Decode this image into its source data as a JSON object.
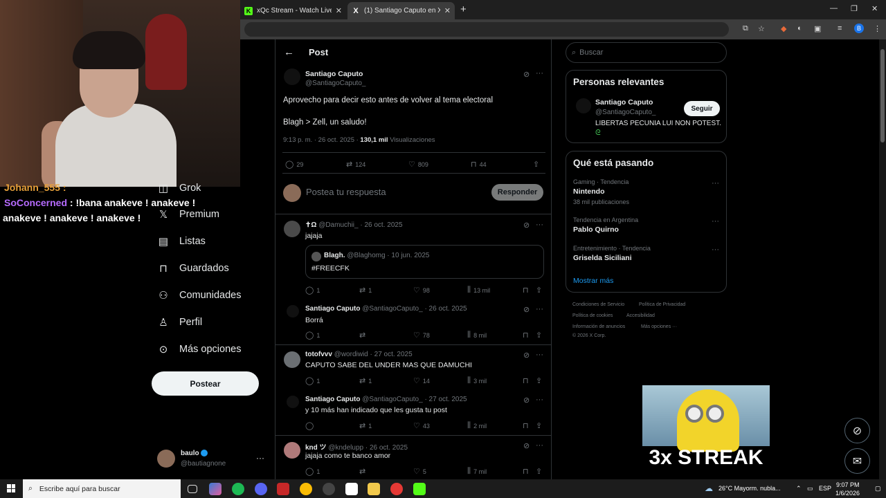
{
  "browser": {
    "tabs": [
      {
        "label": "xQc Stream - Watch Live on Kick",
        "favicon": "K"
      },
      {
        "label": "(1) Santiago Caputo en X: \"Aprovecho",
        "favicon": "X"
      }
    ],
    "new_tab": "+",
    "window_controls": [
      "—",
      "❐",
      "✕"
    ],
    "toolbar_profile": "B"
  },
  "stream": {
    "chat": [
      {
        "user": "Johann_555",
        "sep": " : ",
        "text": ""
      },
      {
        "user": "SoConcerned",
        "sep": " : ",
        "text": "!bana anakeve ! anakeve !"
      },
      {
        "user": "",
        "sep": "",
        "text": "anakeve ! anakeve ! anakeve !"
      }
    ],
    "streak_text": "3x STREAK"
  },
  "nav": {
    "items": [
      {
        "label": "Grok",
        "icon": "grok-icon"
      },
      {
        "label": "Premium",
        "icon": "x-logo-icon"
      },
      {
        "label": "Listas",
        "icon": "list-icon"
      },
      {
        "label": "Guardados",
        "icon": "bookmark-icon"
      },
      {
        "label": "Comunidades",
        "icon": "communities-icon"
      },
      {
        "label": "Perfil",
        "icon": "profile-icon"
      },
      {
        "label": "Más opciones",
        "icon": "more-circle-icon"
      }
    ],
    "post_button": "Postear",
    "account": {
      "name": "baulo",
      "handle": "@bautiagnone"
    }
  },
  "main": {
    "header": "Post",
    "tweet": {
      "name": "Santiago Caputo",
      "handle": "@SantiagoCaputo_",
      "text1": "Aprovecho para decir esto antes de volver al tema electoral",
      "text2": "Blagh > Zell, un saludo!",
      "meta": "9:13 p. m. · 26 oct. 2025 · ",
      "views": "130,1 mil",
      "views_label": " Visualizaciones",
      "replies": "29",
      "retweets": "124",
      "likes": "809",
      "bookmarks": "44"
    },
    "reply_placeholder": "Postea tu respuesta",
    "reply_button": "Responder",
    "replies": [
      {
        "name": "✝Ω",
        "handle": "@Damuchii_ · 26 oct. 2025",
        "text": "jajaja",
        "quote": {
          "name": "Blagh.",
          "handle": "@Blaghomg · 10 jun. 2025",
          "text": "#FREECFK"
        },
        "stats": {
          "replies": "1",
          "retweets": "1",
          "likes": "98",
          "views": "13 mil"
        }
      },
      {
        "name": "Santiago Caputo",
        "handle": "@SantiagoCaputo_ · 26 oct. 2025",
        "text": "Borrá",
        "stats": {
          "replies": "1",
          "retweets": "",
          "likes": "78",
          "views": "8 mil"
        }
      },
      {
        "name": "totofvvv",
        "handle": "@wordiwid · 27 oct. 2025",
        "text": "CAPUTO SABE DEL UNDER MAS QUE DAMUCHI",
        "stats": {
          "replies": "1",
          "retweets": "1",
          "likes": "14",
          "views": "3 mil"
        }
      },
      {
        "name": "Santiago Caputo",
        "handle": "@SantiagoCaputo_ · 27 oct. 2025",
        "text": "y 10 más han indicado que les gusta tu post",
        "stats": {
          "replies": "",
          "retweets": "1",
          "likes": "43",
          "views": "2 mil"
        }
      },
      {
        "name": "knd ツ",
        "handle": "@kndelupp · 26 oct. 2025",
        "text": "jajaja como te banco amor",
        "stats": {
          "replies": "1",
          "retweets": "",
          "likes": "5",
          "views": "7 mil"
        }
      }
    ]
  },
  "right": {
    "search_placeholder": "Buscar",
    "relevant": {
      "title": "Personas relevantes",
      "name": "Santiago Caputo",
      "handle": "@SantiagoCaputo_",
      "follow": "Seguir",
      "bio": "LIBERTAS PECUNIA LUI NON POTEST."
    },
    "trends": {
      "title": "Qué está pasando",
      "items": [
        {
          "category": "Gaming · Tendencia",
          "name": "Nintendo",
          "count": "38 mil publicaciones"
        },
        {
          "category": "Tendencia en Argentina",
          "name": "Pablo Quirno",
          "count": ""
        },
        {
          "category": "Entretenimiento · Tendencia",
          "name": "Griselda Siciliani",
          "count": ""
        }
      ],
      "show_more": "Mostrar más"
    },
    "footer": {
      "terms": "Condiciones de Servicio",
      "privacy": "Política de Privacidad",
      "cookies": "Política de cookies",
      "access": "Accesibilidad",
      "ads": "Información de anuncios",
      "more": "Más opciones ···",
      "copy": "© 2026 X Corp."
    }
  },
  "taskbar": {
    "search_placeholder": "Escribe aquí para buscar",
    "weather": "26°C  Mayorm. nubla...",
    "lang": "ESP",
    "time": "9:07 PM",
    "date": "1/6/2026"
  }
}
